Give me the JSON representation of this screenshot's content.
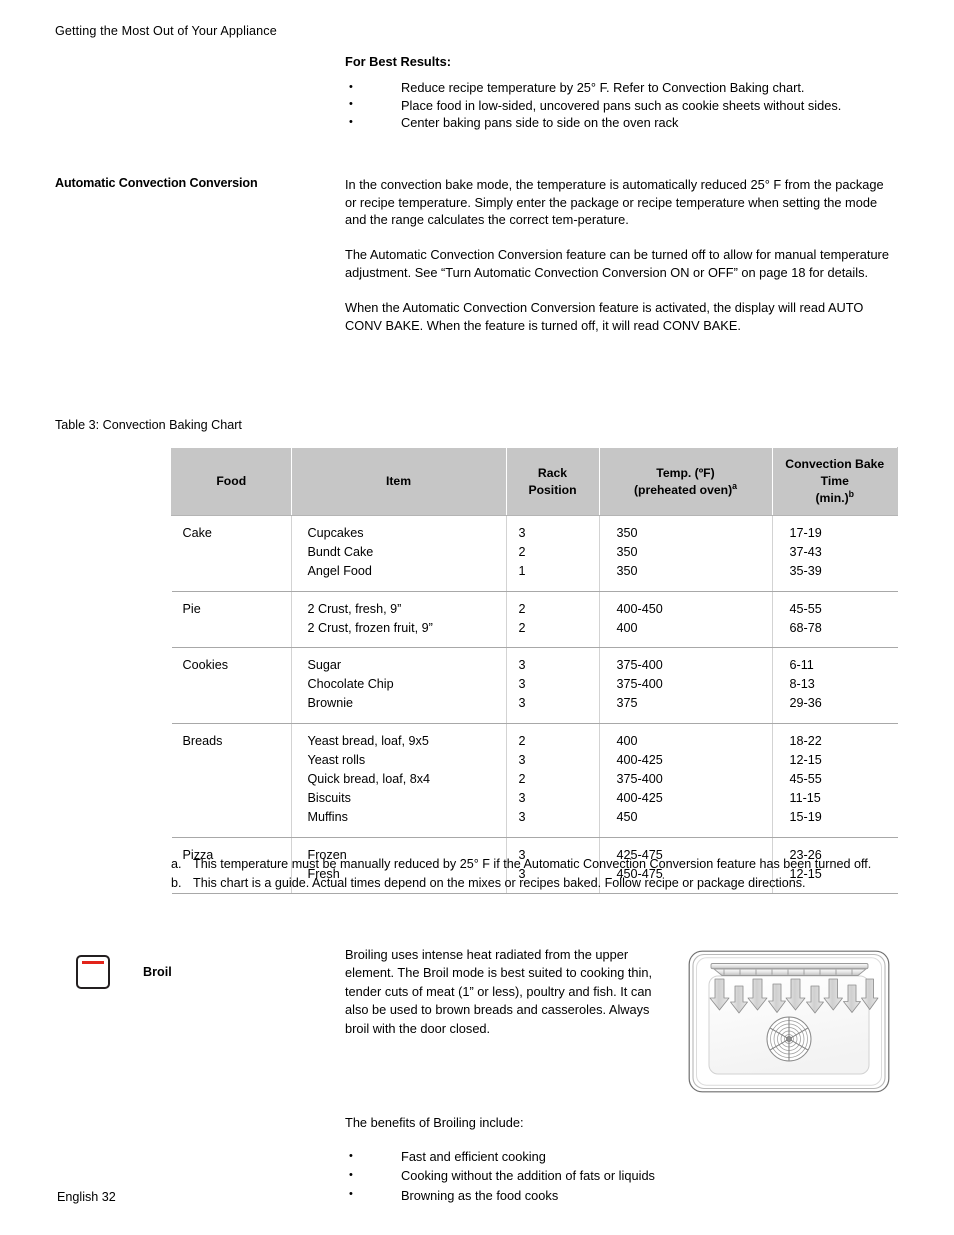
{
  "running_header": "Getting the Most Out of Your Appliance",
  "best_results": {
    "heading": "For Best Results:",
    "bullets": [
      "Reduce recipe temperature by 25° F. Refer to Convection Baking chart.",
      "Place food in low-sided, uncovered pans such as cookie sheets without sides.",
      "Center baking pans side to side on the oven rack"
    ]
  },
  "auto_convection": {
    "label": "Automatic Convection Conversion",
    "paragraphs": [
      "In the convection bake mode, the temperature is automatically reduced 25° F from the package or recipe temperature. Simply enter the package or recipe temperature when setting the mode and the range calculates the correct tem-perature.",
      "The Automatic Convection Conversion feature can be turned off to allow for manual temperature adjustment. See “Turn Automatic Convection Conversion ON or OFF” on page 18 for details.",
      "When the Automatic Convection Conversion feature is activated, the display will read AUTO CONV BAKE. When the feature is turned off, it will read CONV BAKE."
    ]
  },
  "table": {
    "caption": "Table 3: Convection Baking Chart",
    "headers": {
      "food": "Food",
      "item": "Item",
      "rack_line1": "Rack",
      "rack_line2": "Position",
      "temp_line1": "Temp. (ºF)",
      "temp_line2": "(preheated oven)",
      "temp_note": "a",
      "time_line1": "Convection Bake Time",
      "time_line2": "(min.)",
      "time_note": "b"
    },
    "rows": [
      {
        "food": "Cake",
        "items": [
          "Cupcakes",
          "Bundt Cake",
          "Angel Food"
        ],
        "rack": [
          "3",
          "2",
          "1"
        ],
        "temp": [
          "350",
          "350",
          "350"
        ],
        "time": [
          "17-19",
          "37-43",
          "35-39"
        ]
      },
      {
        "food": "Pie",
        "items": [
          "2 Crust, fresh, 9”",
          "2 Crust, frozen fruit, 9”"
        ],
        "rack": [
          "2",
          "2"
        ],
        "temp": [
          "400-450",
          "400"
        ],
        "time": [
          "45-55",
          "68-78"
        ]
      },
      {
        "food": "Cookies",
        "items": [
          "Sugar",
          "Chocolate Chip",
          "Brownie"
        ],
        "rack": [
          "3",
          "3",
          "3"
        ],
        "temp": [
          "375-400",
          "375-400",
          "375"
        ],
        "time": [
          "6-11",
          "8-13",
          "29-36"
        ]
      },
      {
        "food": "Breads",
        "items": [
          "Yeast bread, loaf, 9x5",
          "Yeast rolls",
          "Quick bread, loaf, 8x4",
          "Biscuits",
          "Muffins"
        ],
        "rack": [
          "2",
          "3",
          "2",
          "3",
          "3"
        ],
        "temp": [
          "400",
          "400-425",
          "375-400",
          "400-425",
          "450"
        ],
        "time": [
          "18-22",
          "12-15",
          "45-55",
          "11-15",
          "15-19"
        ]
      },
      {
        "food": "Pizza",
        "items": [
          "Frozen",
          "Fresh"
        ],
        "rack": [
          "3",
          "3"
        ],
        "temp": [
          "425-475",
          "450-475"
        ],
        "time": [
          "23-26",
          "12-15"
        ]
      }
    ],
    "footnotes": [
      {
        "marker": "a.",
        "text": "This temperature must be manually reduced by 25° F if the Automatic Convection Conversion feature has been turned off."
      },
      {
        "marker": "b.",
        "text": "This chart is a guide. Actual times depend on the mixes or recipes baked. Follow recipe or package directions."
      }
    ]
  },
  "broil": {
    "label": "Broil",
    "icon_accent_color": "#e2231a",
    "paragraphs": [
      "Broiling uses intense heat radiated from the upper element. The Broil mode is best suited to cooking thin, tender cuts of meat (1” or less), poultry and fish. It can also be used to brown breads and casseroles. Always broil with the door closed.",
      "The benefits of Broiling include:"
    ],
    "bullets": [
      "Fast and efficient cooking",
      "Cooking without the addition of fats or liquids",
      "Browning as the food cooks"
    ]
  },
  "footer": "English 32"
}
